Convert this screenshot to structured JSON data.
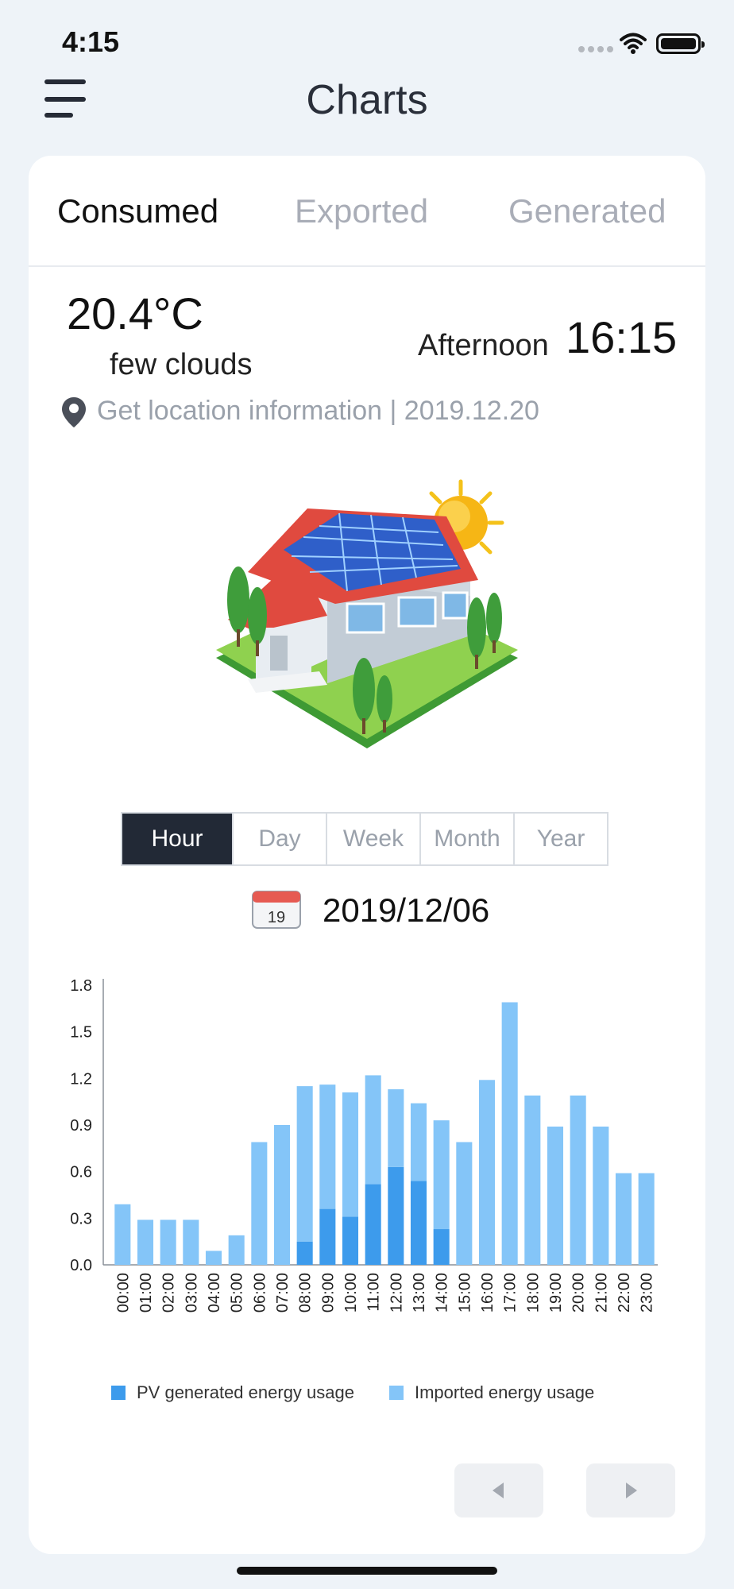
{
  "status_bar": {
    "time": "4:15"
  },
  "nav": {
    "title": "Charts"
  },
  "tabs": {
    "consumed": "Consumed",
    "exported": "Exported",
    "generated": "Generated",
    "active": "Consumed"
  },
  "weather": {
    "temperature": "20.4°C",
    "condition": "few clouds",
    "daypart": "Afternoon",
    "time": "16:15",
    "location_line": "Get location information | 2019.12.20"
  },
  "periods": {
    "items": [
      "Hour",
      "Day",
      "Week",
      "Month",
      "Year"
    ],
    "active": "Hour"
  },
  "calendar": {
    "icon_day": "19"
  },
  "date": {
    "label": "2019/12/06"
  },
  "colors": {
    "pv": "#3d9bec",
    "imported": "#84c5f8",
    "active_segment": "#222936"
  },
  "chart_data": {
    "type": "bar",
    "stacked": true,
    "categories": [
      "00:00",
      "01:00",
      "02:00",
      "03:00",
      "04:00",
      "05:00",
      "06:00",
      "07:00",
      "08:00",
      "09:00",
      "10:00",
      "11:00",
      "12:00",
      "13:00",
      "14:00",
      "15:00",
      "16:00",
      "17:00",
      "18:00",
      "19:00",
      "20:00",
      "21:00",
      "22:00",
      "23:00"
    ],
    "series": [
      {
        "name": "PV generated energy usage",
        "values": [
          0,
          0,
          0,
          0,
          0,
          0,
          0,
          0,
          0.15,
          0.36,
          0.31,
          0.52,
          0.63,
          0.54,
          0.23,
          0,
          0,
          0,
          0,
          0,
          0,
          0,
          0,
          0
        ]
      },
      {
        "name": "Imported energy usage",
        "values": [
          0.39,
          0.29,
          0.29,
          0.29,
          0.09,
          0.19,
          0.79,
          0.9,
          1.0,
          0.8,
          0.8,
          0.7,
          0.5,
          0.5,
          0.7,
          0.79,
          1.19,
          1.69,
          1.09,
          0.89,
          1.09,
          0.89,
          0.59,
          0.59
        ]
      }
    ],
    "yticks": [
      "0.0",
      "0.3",
      "0.6",
      "0.9",
      "1.2",
      "1.5",
      "1.8"
    ],
    "ylim": [
      0,
      1.8
    ],
    "legend_position": "bottom",
    "grid": false
  }
}
